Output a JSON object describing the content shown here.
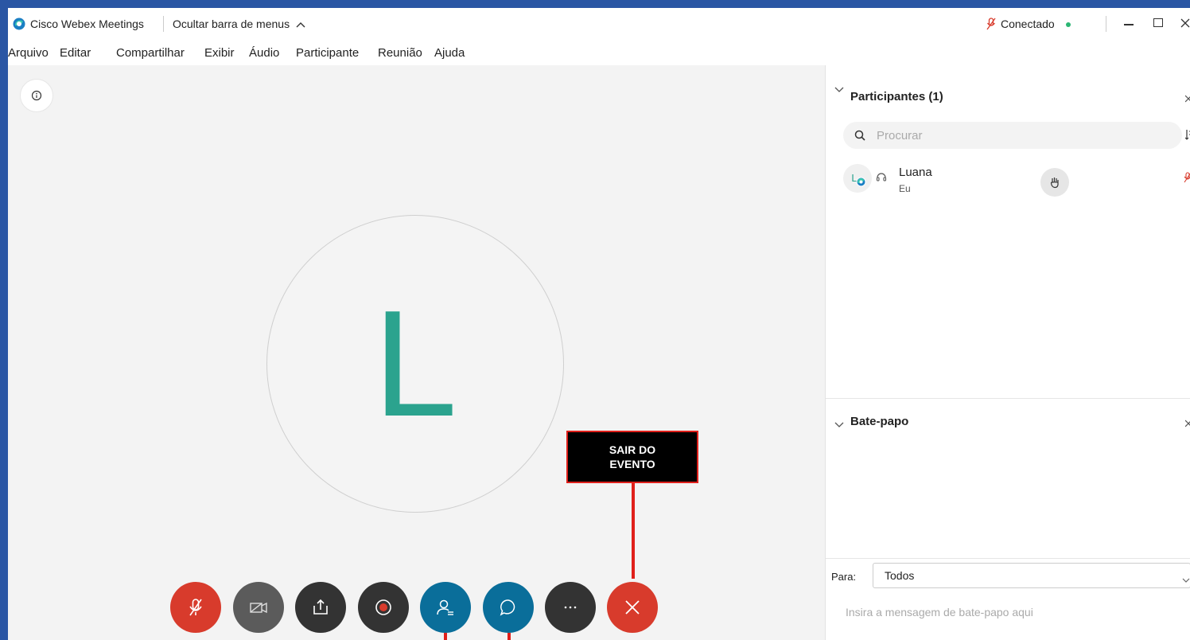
{
  "title_bar": {
    "app_title": "Cisco Webex Meetings",
    "hide_menu": "Ocultar barra de menus",
    "status": "Conectado",
    "status_color": "#2bb673",
    "mic_muted_color": "#d83b2c"
  },
  "menu": {
    "items": [
      "Arquivo",
      "Editar",
      "Compartilhar",
      "Exibir",
      "Áudio",
      "Participante",
      "Reunião",
      "Ajuda"
    ]
  },
  "stage": {
    "avatar_letter": "L",
    "avatar_color": "#2ba38e",
    "annotation": "SAIR DO EVENTO",
    "annotation_line1": "SAIR DO",
    "annotation_line2": "EVENTO"
  },
  "controls": [
    {
      "name": "mute",
      "color": "#d83b2c",
      "icon": "mic-off-icon"
    },
    {
      "name": "video",
      "color": "#5b5b5b",
      "icon": "camera-off-icon"
    },
    {
      "name": "share",
      "color": "#333333",
      "icon": "share-icon"
    },
    {
      "name": "record",
      "color": "#333333",
      "icon": "record-icon"
    },
    {
      "name": "participants",
      "color": "#0a6e9a",
      "icon": "participants-icon"
    },
    {
      "name": "chat",
      "color": "#0a6e9a",
      "icon": "chat-icon"
    },
    {
      "name": "more",
      "color": "#333333",
      "icon": "more-icon"
    },
    {
      "name": "leave",
      "color": "#d83b2c",
      "icon": "close-icon"
    }
  ],
  "participants_panel": {
    "title": "Participantes (1)",
    "search_placeholder": "Procurar",
    "participants": [
      {
        "initial": "L",
        "name": "Luana",
        "role": "Eu"
      }
    ]
  },
  "chat_panel": {
    "title": "Bate-papo",
    "to_label": "Para:",
    "to_value": "Todos",
    "message_placeholder": "Insira a mensagem de bate-papo aqui"
  }
}
